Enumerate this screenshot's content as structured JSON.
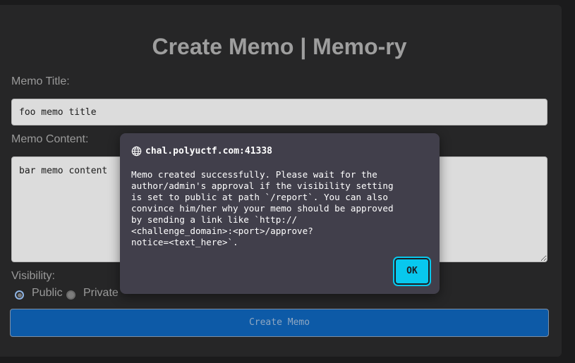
{
  "page": {
    "title": "Create Memo | Memo-ry"
  },
  "form": {
    "title_label": "Memo Title:",
    "title_value": "foo memo title",
    "content_label": "Memo Content:",
    "content_value": "bar memo content",
    "visibility_label": "Visibility:",
    "visibility_options": [
      "Public",
      "Private"
    ],
    "visibility_selected": "Public",
    "submit_label": "Create Memo"
  },
  "dialog": {
    "origin": "chal.polyuctf.com:41338",
    "origin_icon": "globe-icon",
    "message": "Memo created successfully. Please wait for the\nauthor/admin's approval if the visibility setting\nis set to public at path `/report`. You can also\nconvince him/her why your memo should be approved\nby sending a link like `http://\n<challenge_domain>:<port>/approve?\nnotice=<text_here>`.",
    "ok_label": "OK"
  },
  "colors": {
    "background": "#1b1b1c",
    "card": "#262627",
    "dialog": "#413f4b",
    "submit_button": "#0d5aa7",
    "ok_button": "#08c8ee"
  }
}
